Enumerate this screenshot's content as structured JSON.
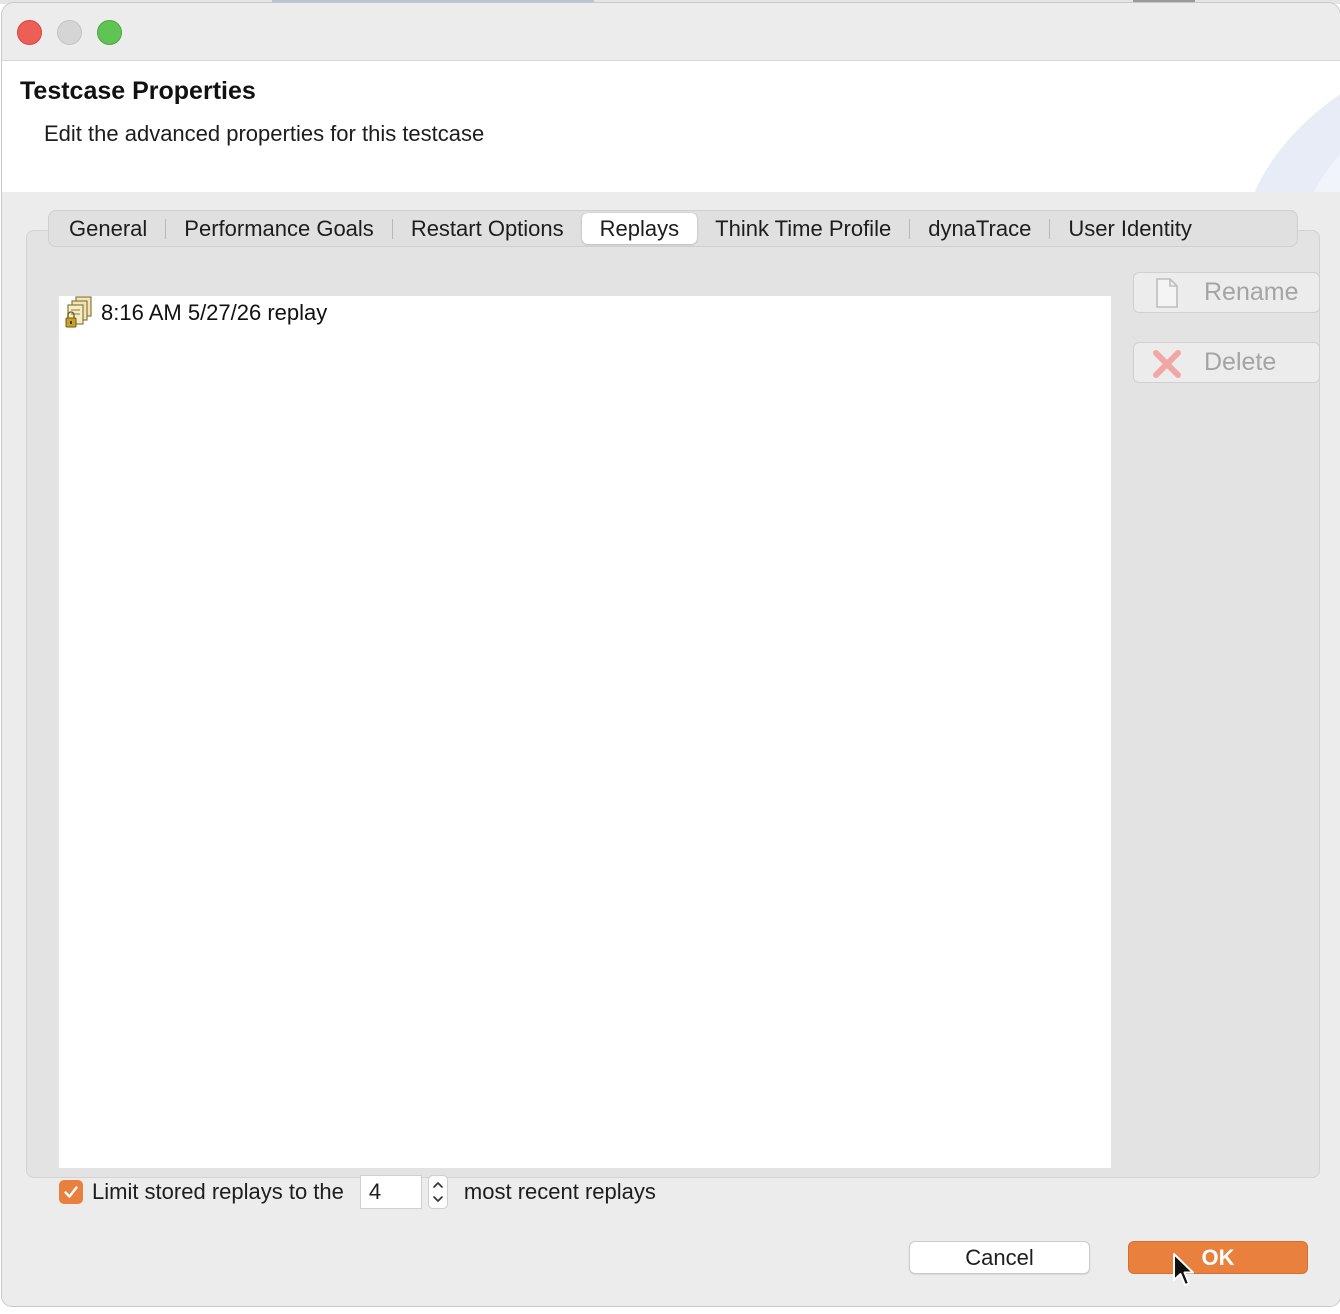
{
  "dialog": {
    "title": "Testcase Properties",
    "description": "Edit the advanced properties for this testcase"
  },
  "tabs": [
    {
      "label": "General",
      "active": false
    },
    {
      "label": "Performance Goals",
      "active": false
    },
    {
      "label": "Restart Options",
      "active": false
    },
    {
      "label": "Replays",
      "active": true
    },
    {
      "label": "Think Time Profile",
      "active": false
    },
    {
      "label": "dynaTrace",
      "active": false
    },
    {
      "label": "User Identity",
      "active": false
    }
  ],
  "replays": {
    "items": [
      {
        "label": "8:16 AM 5/27/26 replay",
        "icon": "replay-stack-icon"
      }
    ],
    "rename_label": "Rename",
    "delete_label": "Delete",
    "limit": {
      "checked": true,
      "prefix": "Limit stored replays to the",
      "value": "4",
      "suffix": "most recent replays"
    }
  },
  "buttons": {
    "cancel": "Cancel",
    "ok": "OK"
  },
  "colors": {
    "accent": "#e9803e",
    "close": "#ec5f57",
    "minimize": "#d5d5d5",
    "maximize": "#5fc453"
  }
}
